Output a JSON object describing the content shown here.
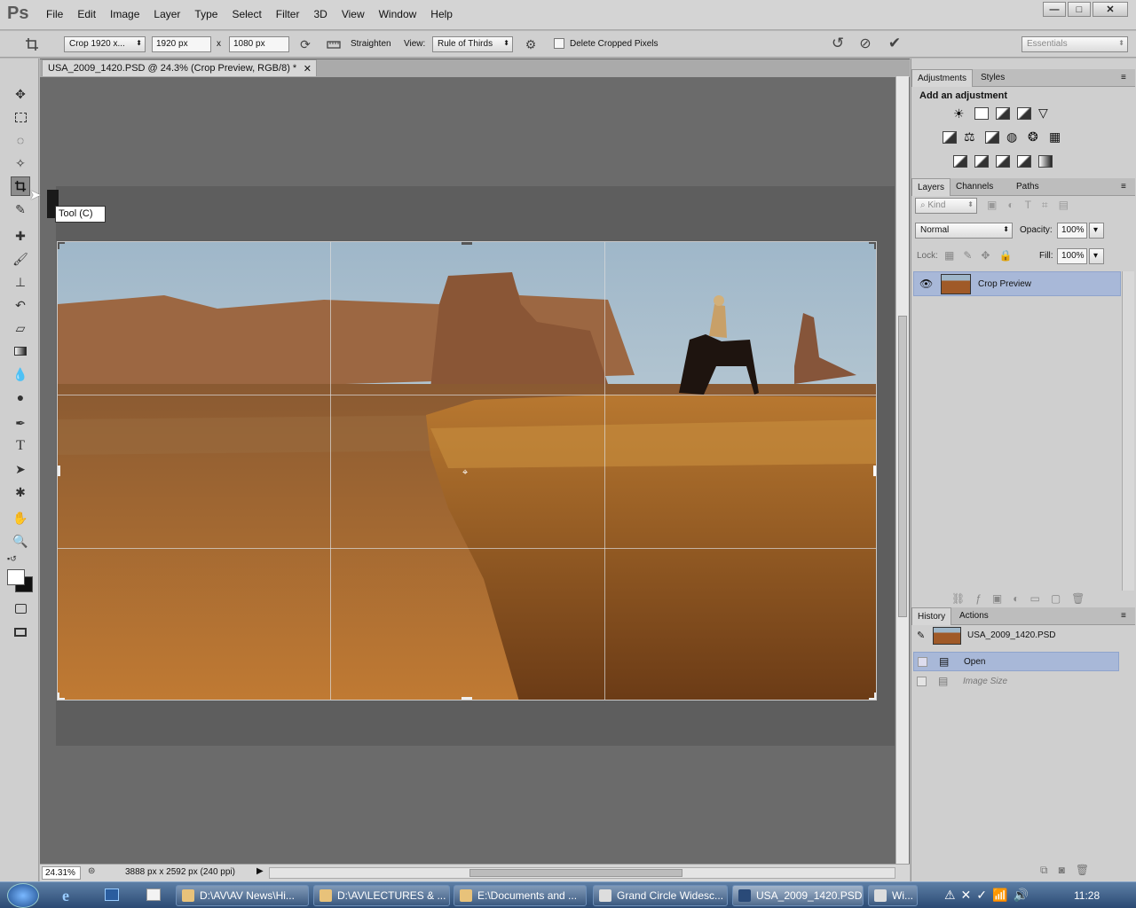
{
  "app": {
    "logo": "Ps"
  },
  "menu": [
    "File",
    "Edit",
    "Image",
    "Layer",
    "Type",
    "Select",
    "Filter",
    "3D",
    "View",
    "Window",
    "Help"
  ],
  "window_controls": {
    "minimize": "—",
    "maximize": "□",
    "close": "✕"
  },
  "options": {
    "preset": "Crop 1920 x...",
    "width": "1920 px",
    "times": "x",
    "height": "1080 px",
    "straighten_label": "Straighten",
    "view_label": "View:",
    "view_value": "Rule of Thirds",
    "delete_cropped_label": "Delete Cropped Pixels",
    "delete_cropped_checked": false,
    "workspace": "Essentials"
  },
  "document": {
    "tab_title": "USA_2009_1420.PSD @ 24.3% (Crop Preview, RGB/8) *",
    "tooltip": "Tool (C)",
    "zoom": "24.31%",
    "doc_info": "3888 px x 2592 px (240 ppi)"
  },
  "panels": {
    "adjustments_tab": "Adjustments",
    "styles_tab": "Styles",
    "add_adjustment": "Add an adjustment",
    "layers_tab": "Layers",
    "channels_tab": "Channels",
    "paths_tab": "Paths",
    "kind": "Kind",
    "blend_mode": "Normal",
    "opacity_label": "Opacity:",
    "opacity_value": "100%",
    "lock_label": "Lock:",
    "fill_label": "Fill:",
    "fill_value": "100%",
    "layer_name": "Crop Preview",
    "history_tab": "History",
    "actions_tab": "Actions",
    "history_snapshot": "USA_2009_1420.PSD",
    "history_items": [
      "Open",
      "Image Size"
    ]
  },
  "taskbar": {
    "buttons": [
      "D:\\AV\\AV News\\Hi...",
      "D:\\AV\\LECTURES & ...",
      "E:\\Documents and ...",
      "Grand Circle Widesc...",
      "USA_2009_1420.PSD...",
      "Wi..."
    ],
    "clock": "11:28"
  },
  "colors": {
    "accent_selection": "#a8b8d8",
    "doc_bg": "#6b6b6b"
  }
}
